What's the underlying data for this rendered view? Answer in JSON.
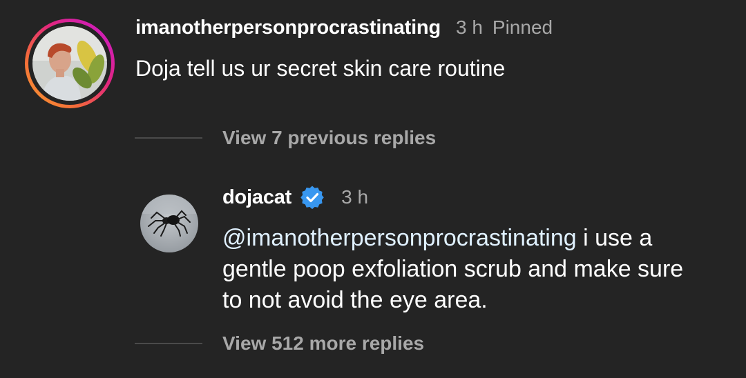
{
  "comment": {
    "username": "imanotherpersonprocrastinating",
    "time": "3 h",
    "pinned_label": "Pinned",
    "text": "Doja tell us ur secret skin care routine",
    "avatar_icon": "profile-photo-person-with-plant",
    "ring_colors": [
      "#f9a22f",
      "#e2267e",
      "#c71ad4"
    ]
  },
  "view_previous": {
    "label": "View 7 previous replies"
  },
  "reply": {
    "username": "dojacat",
    "verified_icon": "verified-badge-icon",
    "verified_color": "#3897f0",
    "time": "3 h",
    "mention": "@imanotherpersonprocrastinating",
    "text": " i use a gentle poop exfoliation scrub and make sure to not avoid the eye area.",
    "avatar_icon": "profile-photo-spider"
  },
  "view_more": {
    "label": "View 512 more replies"
  },
  "colors": {
    "background": "#242424",
    "primary_text": "#ffffff",
    "secondary_text": "#a8a8a8"
  }
}
